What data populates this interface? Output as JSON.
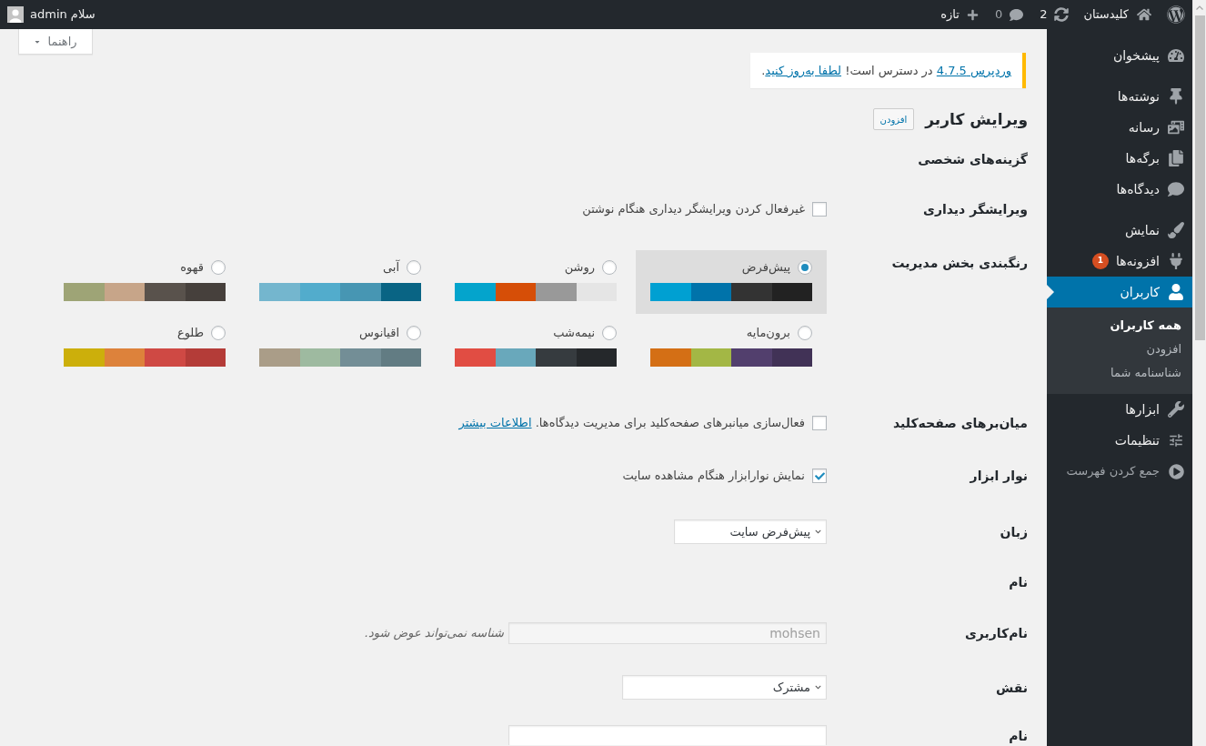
{
  "admin_bar": {
    "site_name": "کلیدستان",
    "updates_count": "2",
    "comments_count": "0",
    "new_label": "تازه",
    "greeting": "سلام admin"
  },
  "sidebar": {
    "groups": [
      {
        "items": [
          {
            "label": "پیشخوان",
            "selected": false
          }
        ]
      },
      {
        "items": [
          {
            "label": "نوشته‌ها",
            "selected": false
          },
          {
            "label": "رسانه",
            "selected": false
          },
          {
            "label": "برگه‌ها",
            "selected": false
          },
          {
            "label": "دیدگاه‌ها",
            "selected": false
          }
        ]
      },
      {
        "items": [
          {
            "label": "نمایش",
            "selected": false
          },
          {
            "label": "افزونه‌ها",
            "selected": false,
            "badge": "1"
          },
          {
            "label": "کاربران",
            "selected": true,
            "submenu": [
              {
                "label": "همه کاربران",
                "selected": true
              },
              {
                "label": "افزودن",
                "selected": false
              },
              {
                "label": "شناسنامه شما",
                "selected": false
              }
            ]
          },
          {
            "label": "ابزارها",
            "selected": false
          },
          {
            "label": "تنظیمات",
            "selected": false
          }
        ]
      }
    ],
    "collapse_label": "جمع کردن فهرست"
  },
  "help_tab": {
    "label": "راهنما"
  },
  "notice": {
    "segments": [
      {
        "kind": "link",
        "text": "وردپرس 4.7.5"
      },
      {
        "kind": "text",
        "text": " در دسترس است! "
      },
      {
        "kind": "link",
        "text": "لطفا به‌روز کنید"
      },
      {
        "kind": "text",
        "text": "."
      }
    ]
  },
  "page": {
    "title": "ویرایش کاربر",
    "add_button": "افزودن",
    "section_title": "گزینه‌های شخصی"
  },
  "rows": [
    {
      "kind": "checkbox",
      "label": "ویرایشگر دیداری",
      "text": "غیرفعال کردن ویرایشگر دیداری هنگام نوشتن",
      "checked": false
    },
    {
      "kind": "color_schemes",
      "label": "رنگبندی بخش مدیریت",
      "schemes": [
        {
          "name": "پیش‌فرض",
          "selected": true,
          "swatches": [
            {
              "color": "#222222"
            },
            {
              "color": "#333333"
            },
            {
              "color": "#0073aa"
            },
            {
              "color": "#00a0d2"
            }
          ]
        },
        {
          "name": "روشن",
          "selected": false,
          "swatches": [
            {
              "color": "#e5e5e5"
            },
            {
              "color": "#999999"
            },
            {
              "color": "#d64e07"
            },
            {
              "color": "#04a4cc"
            }
          ]
        },
        {
          "name": "آبی",
          "selected": false,
          "swatches": [
            {
              "color": "#096484"
            },
            {
              "color": "#4796b3"
            },
            {
              "color": "#52accc"
            },
            {
              "color": "#74b6ce"
            }
          ]
        },
        {
          "name": "قهوه",
          "selected": false,
          "swatches": [
            {
              "color": "#46403c"
            },
            {
              "color": "#59524c"
            },
            {
              "color": "#c7a589"
            },
            {
              "color": "#9ea476"
            }
          ]
        },
        {
          "name": "برون‌مایه",
          "selected": false,
          "swatches": [
            {
              "color": "#413256"
            },
            {
              "color": "#523f6d"
            },
            {
              "color": "#a3b745"
            },
            {
              "color": "#d46f15"
            }
          ]
        },
        {
          "name": "نیمه‌شب",
          "selected": false,
          "swatches": [
            {
              "color": "#25282b"
            },
            {
              "color": "#363b3f"
            },
            {
              "color": "#69a8bb"
            },
            {
              "color": "#e14d43"
            }
          ]
        },
        {
          "name": "اقیانوس",
          "selected": false,
          "swatches": [
            {
              "color": "#627c83"
            },
            {
              "color": "#738e96"
            },
            {
              "color": "#9ebaa0"
            },
            {
              "color": "#aa9d88"
            }
          ]
        },
        {
          "name": "طلوع",
          "selected": false,
          "swatches": [
            {
              "color": "#b43c38"
            },
            {
              "color": "#cf4944"
            },
            {
              "color": "#dd823b"
            },
            {
              "color": "#ccaf0b"
            }
          ]
        }
      ]
    },
    {
      "kind": "checkbox",
      "label": "میان‌برهای صفحه‌کلید",
      "text": "فعال‌سازی میانبرهای صفحه‌کلید برای مدیریت دیدگاه‌ها.",
      "link": "اطلاعات بیشتر",
      "checked": false
    },
    {
      "kind": "checkbox",
      "label": "نوار ابزار",
      "text": "نمایش نوارابزار هنگام مشاهده سایت",
      "checked": true
    },
    {
      "kind": "select",
      "label": "زبان",
      "value": "پیش‌فرض سایت"
    },
    {
      "kind": "heading",
      "label": "نام"
    },
    {
      "kind": "text_input",
      "label": "نام‌کاربری",
      "value": "mohsen",
      "disabled": true,
      "description": "شناسه نمی‌تواند عوض شود."
    },
    {
      "kind": "select",
      "label": "نقش",
      "value": "مشترک"
    },
    {
      "kind": "text_input",
      "label": "نام"
    }
  ]
}
